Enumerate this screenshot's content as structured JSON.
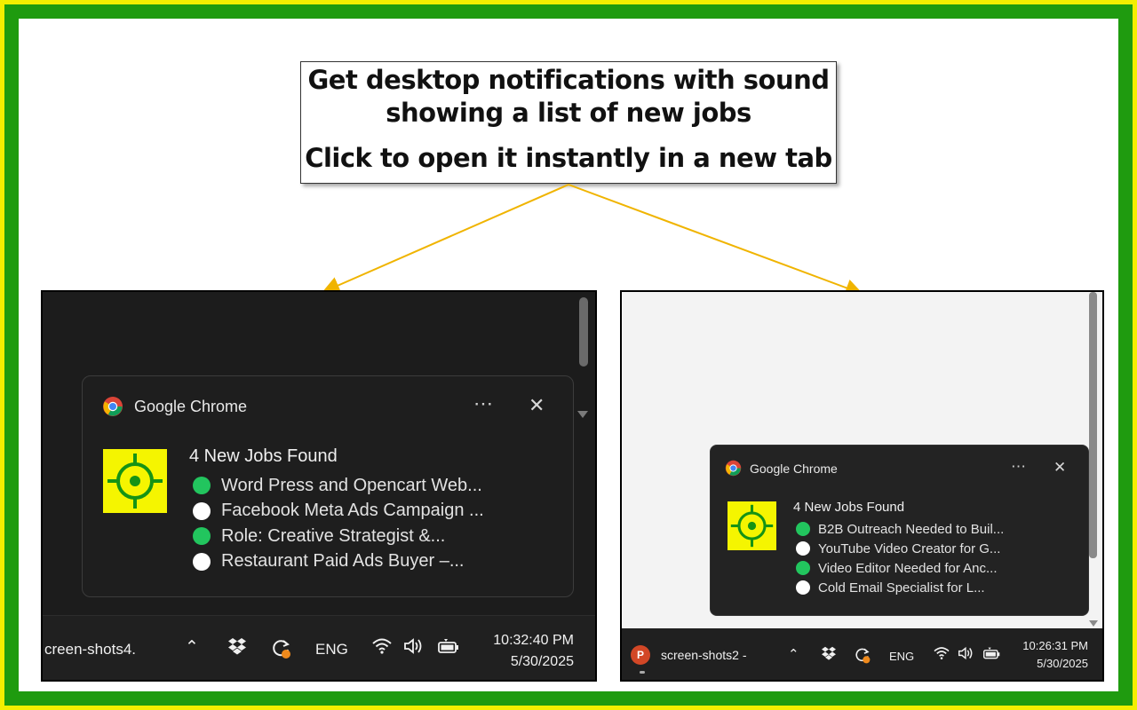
{
  "callout": {
    "line1": "Get desktop notifications with sound",
    "line2": "showing a list of new jobs",
    "line3": "Click to open it instantly in a new tab"
  },
  "colors": {
    "frame_outer": "#f3ef00",
    "frame_green": "#1f9b0f",
    "arrow": "#f0b400",
    "dot_green": "#22c55e",
    "dot_white": "#ffffff",
    "app_icon_bg": "#f5f500",
    "crosshair": "#159315"
  },
  "left": {
    "notification": {
      "app_name": "Google Chrome",
      "more_icon": "more-options-icon",
      "close_icon": "close-icon",
      "title": "4 New Jobs Found",
      "jobs": [
        {
          "text": "Word Press and Opencart Web...",
          "status": "green"
        },
        {
          "text": "Facebook Meta Ads Campaign ...",
          "status": "white"
        },
        {
          "text": "Role: Creative Strategist &...",
          "status": "green"
        },
        {
          "text": "Restaurant Paid Ads Buyer –...",
          "status": "white"
        }
      ]
    },
    "taskbar": {
      "app_label": "creen-shots4.",
      "lang": "ENG",
      "time": "10:32:40 PM",
      "date": "5/30/2025"
    }
  },
  "right": {
    "notification": {
      "app_name": "Google Chrome",
      "more_icon": "more-options-icon",
      "close_icon": "close-icon",
      "title": "4 New Jobs Found",
      "jobs": [
        {
          "text": "B2B Outreach Needed to Buil...",
          "status": "green"
        },
        {
          "text": "YouTube Video Creator for G...",
          "status": "white"
        },
        {
          "text": "Video Editor Needed for Anc...",
          "status": "green"
        },
        {
          "text": "Cold Email Specialist for L...",
          "status": "white"
        }
      ]
    },
    "taskbar": {
      "ppt_letter": "P",
      "app_label": "screen-shots2 -",
      "lang": "ENG",
      "time": "10:26:31 PM",
      "date": "5/30/2025"
    }
  }
}
